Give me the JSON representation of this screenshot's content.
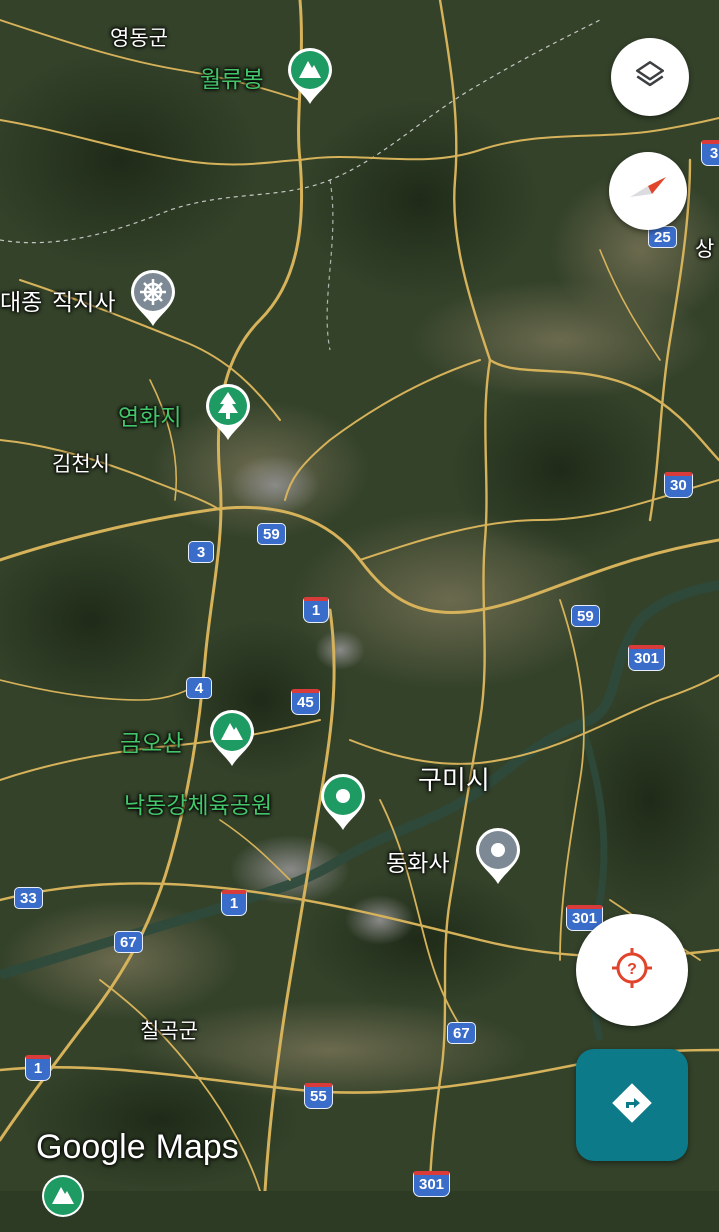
{
  "place_labels": {
    "yeongdong": "영동군",
    "gimcheon": "김천시",
    "chilgok": "칠곡군",
    "sang": "상"
  },
  "city_labels": {
    "gumi": "구미시"
  },
  "pois": {
    "wollyubong": {
      "label": "월류봉",
      "icon": "mountain-pin",
      "color": "#1e9a63"
    },
    "jikjisa": {
      "label": "직지사",
      "prefix": "대종",
      "icon": "temple-pin",
      "color": "#7d8a96"
    },
    "yeonhwaji": {
      "label": "연화지",
      "icon": "tree-pin",
      "color": "#1e9a63"
    },
    "geumosan": {
      "label": "금오산",
      "icon": "mountain-pin",
      "color": "#1e9a63"
    },
    "nakdong_sports_park": {
      "label": "낙동강체육공원",
      "icon": "park-pin",
      "color": "#1e9a63"
    },
    "donghwasa": {
      "label": "동화사",
      "icon": "place-pin",
      "color": "#7d8a96"
    }
  },
  "route_shields": {
    "r3": "3",
    "r59a": "59",
    "r1a": "1",
    "r4": "4",
    "r45": "45",
    "r33": "33",
    "r67a": "67",
    "r1b": "1",
    "r1c": "1",
    "r67b": "67",
    "r55": "55",
    "r301a": "301",
    "r301b": "301",
    "r301c": "301",
    "r59b": "59",
    "r30": "30",
    "r3e": "3",
    "r25": "25"
  },
  "controls": {
    "layers_icon": "layers-icon",
    "compass_icon": "compass-icon",
    "locate_icon": "locate-unknown-icon",
    "directions_icon": "directions-icon"
  },
  "watermark": {
    "google": "Google",
    "maps": "Maps"
  },
  "colors": {
    "poi_green": "#43c56a",
    "shield_blue": "#3a6cc9",
    "expressway_red": "#d93a3a",
    "road_yellow": "#d6b25a",
    "directions_teal": "#0d7a8a",
    "locate_red": "#e0442b"
  }
}
